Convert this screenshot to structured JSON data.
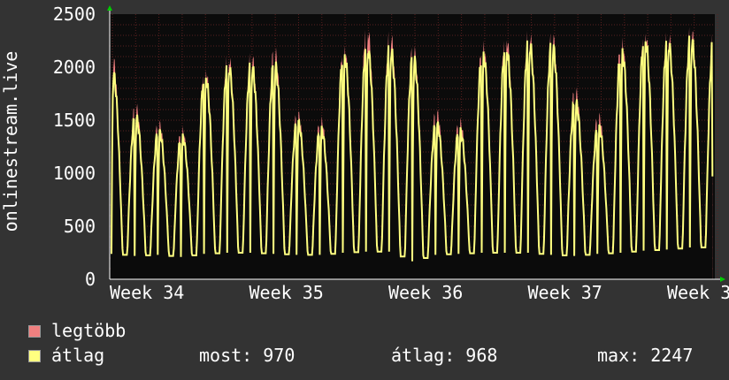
{
  "chart_data": {
    "type": "area",
    "ylabel": "onlinestream.live",
    "yticks": [
      0,
      500,
      1000,
      1500,
      2000,
      2500
    ],
    "ylim": [
      0,
      2500
    ],
    "xticks": [
      "Week 34",
      "Week 35",
      "Week 36",
      "Week 37",
      "Week 3"
    ],
    "grid": true,
    "daily_peaks": {
      "max": [
        2060,
        1610,
        1460,
        1400,
        1950,
        2080,
        2080,
        2130,
        1550,
        1490,
        2160,
        2340,
        2280,
        2150,
        1560,
        1480,
        2190,
        2260,
        2290,
        2270,
        1760,
        1530,
        2210,
        2300,
        2290,
        2320
      ],
      "avg": [
        1930,
        1510,
        1380,
        1330,
        1880,
        1990,
        1990,
        2000,
        1470,
        1400,
        2080,
        2160,
        2150,
        2060,
        1450,
        1390,
        2090,
        2150,
        2200,
        2180,
        1650,
        1420,
        2110,
        2230,
        2210,
        2240
      ]
    },
    "daily_troughs": [
      240,
      220,
      230,
      210,
      240,
      250,
      250,
      240,
      230,
      230,
      250,
      260,
      260,
      170,
      230,
      240,
      250,
      250,
      250,
      230,
      220,
      240,
      250,
      270,
      280,
      300
    ],
    "last_avg": 970,
    "series": [
      {
        "name": "legtöbb",
        "color": "#f08080"
      },
      {
        "name": "átlag",
        "color": "#ffff80"
      }
    ]
  },
  "legend": {
    "max_label": "legtöbb",
    "avg_label": "átlag",
    "now": "most: 970",
    "avg": "átlag: 968",
    "max": "max: 2247"
  },
  "colors": {
    "plot_bg": "#0b0b0b",
    "grid": "#5a2020",
    "axis": "#ffffff",
    "max_fill": "#f08080",
    "avg_line": "#ffff80",
    "arrow": "#00cc00"
  }
}
